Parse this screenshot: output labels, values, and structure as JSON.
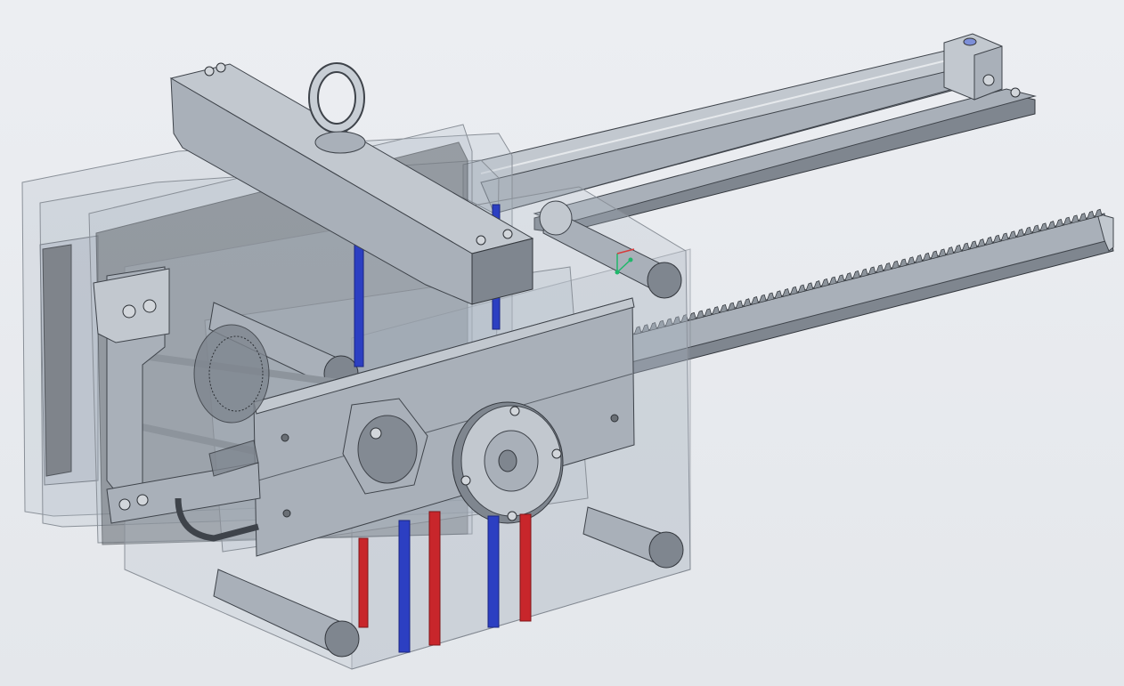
{
  "scene": {
    "title": "",
    "type": "3d-cad-assembly-view",
    "colors": {
      "background": "#e8ebef",
      "steel": "#a9b0b9",
      "cooling_in": "#2c3fc2",
      "cooling_out": "#c8262b",
      "transparent_plate": "rgba(180,190,200,0.28)"
    },
    "components": [
      "lifting-beam",
      "eye-bolt",
      "hydraulic-cylinder",
      "gear-rack",
      "rotary-core",
      "guide-pillars",
      "cooling-channels",
      "mold-plates"
    ],
    "triad": {
      "icon": "coordinate-triad-icon"
    }
  }
}
